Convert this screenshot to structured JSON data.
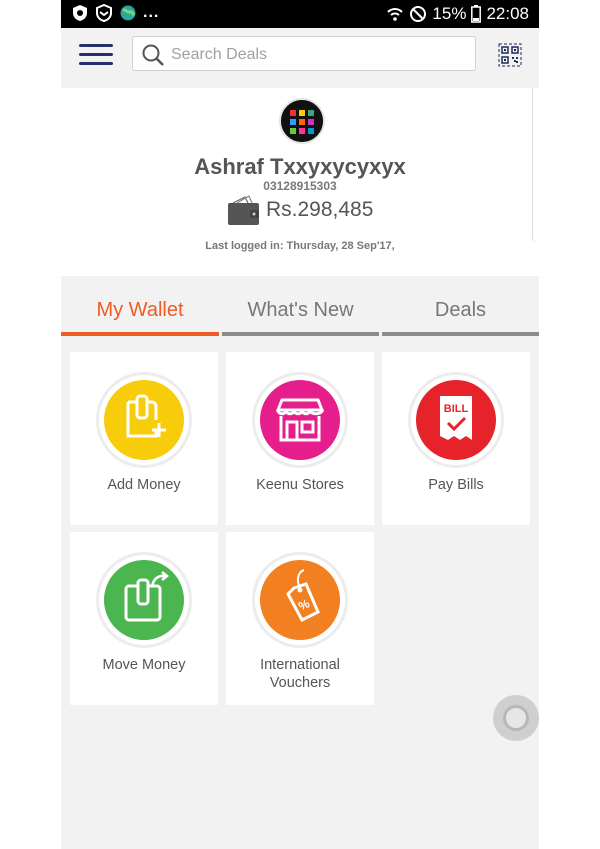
{
  "status_bar": {
    "battery": "15%",
    "time": "22:08",
    "left_icons": [
      "shield-icon",
      "vpn-shield-icon",
      "globe-icon"
    ],
    "overflow": "...",
    "right_icons": [
      "wifi-icon",
      "do-not-disturb-icon",
      "battery-icon"
    ]
  },
  "header": {
    "search": {
      "placeholder": "Search Deals",
      "value": ""
    },
    "menu_icon": "hamburger-icon",
    "qr_icon": "qr-code-icon"
  },
  "profile": {
    "name": "Ashraf Txxyxycyxyx",
    "phone": "03128915303",
    "balance": "Rs.298,485",
    "last_login": "Last logged in: Thursday, 28 Sep'17,"
  },
  "tabs": [
    {
      "label": "My Wallet",
      "active": true
    },
    {
      "label": "What's New",
      "active": false
    },
    {
      "label": "Deals",
      "active": false
    }
  ],
  "tiles": [
    {
      "label": "Add Money",
      "icon": "add-money-icon",
      "color": "#f7cc0a"
    },
    {
      "label": "Keenu Stores",
      "icon": "store-icon",
      "color": "#e61e8c"
    },
    {
      "label": "Pay Bills",
      "icon": "bill-icon",
      "color": "#e6232b",
      "icon_text": "BILL"
    },
    {
      "label": "Move Money",
      "icon": "move-money-icon",
      "color": "#4bb54f"
    },
    {
      "label": "International",
      "label_line2": "Vouchers",
      "icon": "voucher-tag-icon",
      "color": "#f28020",
      "icon_text": "%"
    }
  ],
  "colors": {
    "accent": "#ef5b25",
    "menu": "#27306a",
    "tab_inactive": "#8b8b8b"
  }
}
